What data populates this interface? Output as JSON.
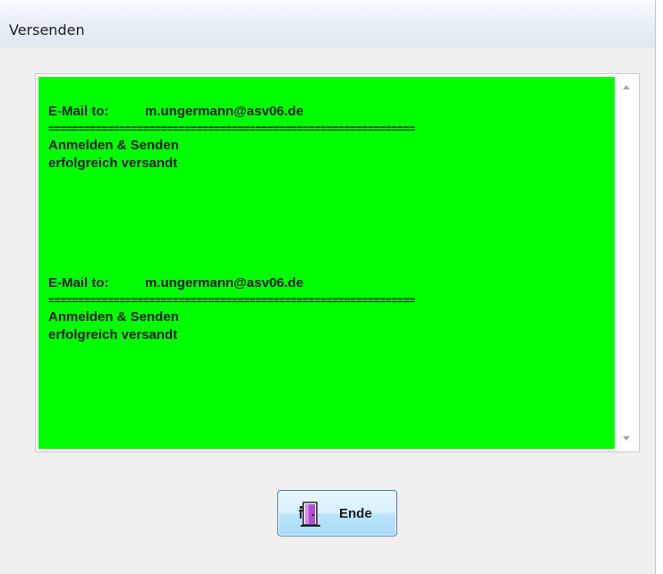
{
  "window": {
    "title": "Versenden"
  },
  "log": {
    "entries": [
      {
        "label": "E-Mail to:",
        "address": "m.ungermann@asv06.de",
        "separator": "==============================================================",
        "line1": "Anmelden & Senden",
        "line2": "erfolgreich versandt"
      },
      {
        "label": "E-Mail to:",
        "address": "m.ungermann@asv06.de",
        "separator": "==============================================================",
        "line1": "Anmelden & Senden",
        "line2": "erfolgreich versandt"
      }
    ],
    "background_color": "#00ff00"
  },
  "buttons": {
    "end_label": "Ende",
    "end_icon": "exit-door-icon"
  }
}
